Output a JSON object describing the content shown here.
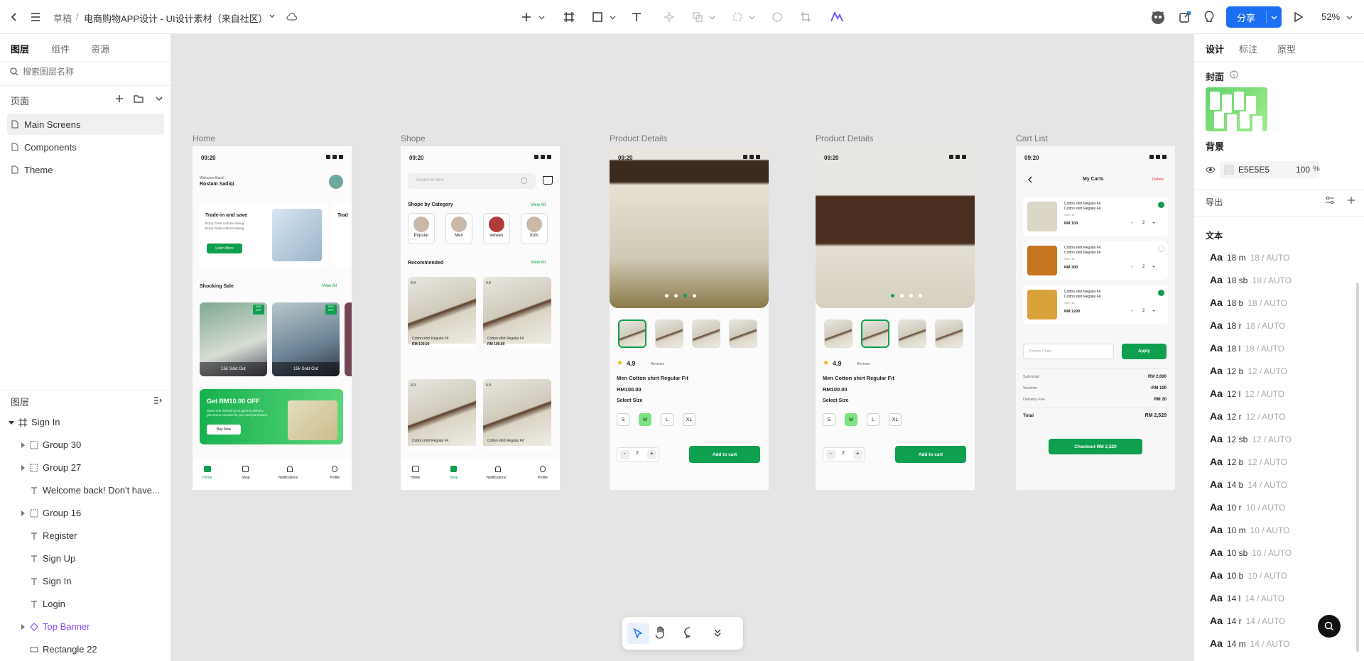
{
  "topbar": {
    "breadcrumb_root": "草稿",
    "separator": "/",
    "file_title": "电商购物APP设计 - UI设计素材（来自社区）",
    "share_label": "分享",
    "zoom": "52%"
  },
  "left_panel": {
    "tabs": [
      "图层",
      "组件",
      "资源"
    ],
    "search_placeholder": "搜索图层名称",
    "pages_title": "页面",
    "pages": [
      "Main Screens",
      "Components",
      "Theme"
    ],
    "layers_title": "图层",
    "layers": [
      {
        "name": "Sign In",
        "icon": "frame-icon",
        "expand": true
      },
      {
        "name": "Group 30",
        "icon": "group-icon",
        "expand": true
      },
      {
        "name": "Group 27",
        "icon": "group-icon",
        "expand": true
      },
      {
        "name": "Welcome back! Don't have...",
        "icon": "text-icon",
        "expand": false
      },
      {
        "name": "Group 16",
        "icon": "group-icon",
        "expand": true
      },
      {
        "name": "Register",
        "icon": "text-icon",
        "expand": false
      },
      {
        "name": "Sign Up",
        "icon": "text-icon",
        "expand": false
      },
      {
        "name": "Sign In",
        "icon": "text-icon",
        "expand": false
      },
      {
        "name": "Login",
        "icon": "text-icon",
        "expand": false
      },
      {
        "name": "Top Banner",
        "icon": "component-icon",
        "expand": true
      },
      {
        "name": "Rectangle 22",
        "icon": "rectangle-icon",
        "expand": false
      }
    ]
  },
  "right_panel": {
    "tabs": [
      "设计",
      "标注",
      "原型"
    ],
    "cover_title": "封面",
    "background_title": "背景",
    "bg_hex": "E5E5E5",
    "bg_opacity": "100",
    "bg_unit": "%",
    "export_title": "导出",
    "text_title": "文本",
    "text_styles": [
      {
        "name": "18 m",
        "spec": "18 / AUTO"
      },
      {
        "name": "18 sb",
        "spec": "18 / AUTO"
      },
      {
        "name": "18 b",
        "spec": "18 / AUTO"
      },
      {
        "name": "18 r",
        "spec": "18 / AUTO"
      },
      {
        "name": "18 l",
        "spec": "18 / AUTO"
      },
      {
        "name": "12 b",
        "spec": "12 / AUTO"
      },
      {
        "name": "12 l",
        "spec": "12 / AUTO"
      },
      {
        "name": "12 r",
        "spec": "12 / AUTO"
      },
      {
        "name": "12 sb",
        "spec": "12 / AUTO"
      },
      {
        "name": "12 b",
        "spec": "12 / AUTO"
      },
      {
        "name": "14 b",
        "spec": "14 / AUTO"
      },
      {
        "name": "10 r",
        "spec": "10 / AUTO"
      },
      {
        "name": "10 m",
        "spec": "10 / AUTO"
      },
      {
        "name": "10 sb",
        "spec": "10 / AUTO"
      },
      {
        "name": "10 b",
        "spec": "10 / AUTO"
      },
      {
        "name": "14 l",
        "spec": "14 / AUTO"
      },
      {
        "name": "14 r",
        "spec": "14 / AUTO"
      },
      {
        "name": "14 m",
        "spec": "14 / AUTO"
      }
    ],
    "aa": "Aa"
  },
  "canvas": {
    "frame_labels": [
      "Home",
      "Shope",
      "Product Details",
      "Product Details",
      "Cart List"
    ],
    "time": "09:20",
    "home": {
      "welcome": "Welcome Back!",
      "user": "Rostam Sadiqi",
      "banner_title": "Trade-in and save",
      "banner_sub1": "Enjoy Great uniform saving",
      "banner_sub2": "Enjoy Great uniform saving",
      "banner_btn": "Learn More",
      "banner2_title": "Trad",
      "sale_title": "Shocking Sale",
      "view_all": "View All",
      "discount": "50% OFF",
      "sold_out": "15k Sold Out",
      "promo_title": "Get RM10.00 OFF",
      "promo_sub1": "Spent min RM100.00 to get this delivery",
      "promo_sub2": "get promo voucher fix your next purchases.",
      "promo_btn": "Buy Now"
    },
    "nav": [
      "Home",
      "Shop",
      "Notifications",
      "Profile"
    ],
    "shop": {
      "search_placeholder": "Search in here",
      "category_title": "Shope by Category",
      "view_all": "View All",
      "categories": [
        "Popular",
        "Men",
        "wowen",
        "Kids"
      ],
      "recommended_title": "Recommended",
      "rating": "4.9",
      "product_name": "Cotton shirt Regular Fit",
      "price": "RM 100.00"
    },
    "details": {
      "rating": "4.9",
      "reviews": "Reviews",
      "title": "Men Cotton shirt Regular Fit",
      "price": "RM100.00",
      "size_title": "Select Size",
      "sizes": [
        "S",
        "M",
        "L",
        "XL"
      ],
      "qty": "2",
      "minus": "-",
      "plus": "+",
      "add_btn": "Add to cart"
    },
    "cart": {
      "title": "My Carts",
      "delete": "Delete",
      "item_name": "Cotton shirt Regular Fit",
      "size": "Size: 14",
      "items": [
        {
          "price": "RM 100",
          "qty": "2"
        },
        {
          "price": "RM 300",
          "qty": "2"
        },
        {
          "price": "RM 1200",
          "qty": "2"
        }
      ],
      "promo_placeholder": "Promo Code",
      "apply": "Apply",
      "subtotal_label": "Sub-total",
      "subtotal": "RM 2,600",
      "voucher_label": "Voucher",
      "voucher": "-RM 100",
      "delivery_label": "Delivery Fee",
      "delivery": "RM 20",
      "total_label": "Total",
      "total": "RM 2,520",
      "checkout": "Checkout RM 2,520"
    }
  }
}
